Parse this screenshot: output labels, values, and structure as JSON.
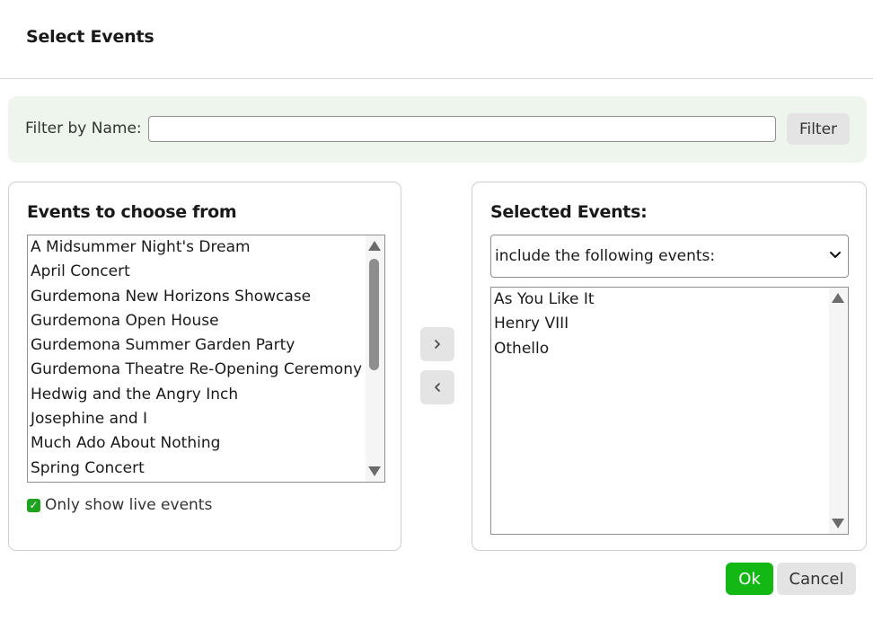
{
  "dialog": {
    "title": "Select Events"
  },
  "filter": {
    "label": "Filter by Name:",
    "value": "",
    "placeholder": "",
    "button_label": "Filter"
  },
  "available": {
    "title": "Events to choose from",
    "items": [
      "A Midsummer Night's Dream",
      "April Concert",
      "Gurdemona New Horizons Showcase",
      "Gurdemona Open House",
      "Gurdemona Summer Garden Party",
      "Gurdemona Theatre Re-Opening Ceremony",
      "Hedwig and the Angry Inch",
      "Josephine and I",
      "Much Ado About Nothing",
      "Spring Concert"
    ],
    "live_only": {
      "label": "Only show live events",
      "checked": true
    }
  },
  "transfer": {
    "add_icon": "chevron-right-icon",
    "remove_icon": "chevron-left-icon"
  },
  "selected": {
    "title": "Selected Events:",
    "mode": "include the following events:",
    "items": [
      "As You Like It",
      "Henry VIII",
      "Othello"
    ]
  },
  "footer": {
    "ok_label": "Ok",
    "cancel_label": "Cancel"
  },
  "colors": {
    "accent": "#14b814",
    "filter_bg": "#eef5ec",
    "button_bg": "#e4e4e4"
  }
}
